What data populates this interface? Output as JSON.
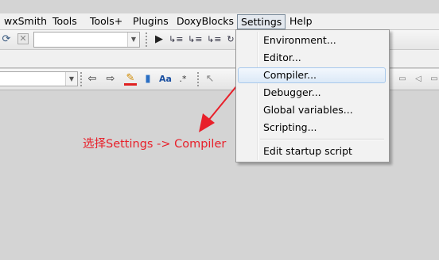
{
  "menubar": {
    "items": [
      "wxSmith",
      "Tools",
      "Tools+",
      "Plugins",
      "DoxyBlocks",
      "Settings",
      "Help"
    ],
    "open_index": 5
  },
  "settings_menu": {
    "items": [
      "Environment...",
      "Editor...",
      "Compiler...",
      "Debugger...",
      "Global variables...",
      "Scripting...",
      "Edit startup script"
    ],
    "highlighted": "Compiler..."
  },
  "toolbar1": {
    "icons": [
      "refresh-icon",
      "stop-icon",
      "run-icon",
      "debug-step-icon"
    ],
    "combo_value": ""
  },
  "toolbar2": {
    "combo_value": "",
    "icons": [
      "arrow-left-icon",
      "arrow-right-icon",
      "highlight-icon",
      "bookmark-icon",
      "match-case-icon",
      "regex-icon"
    ],
    "match_case_label": "Aa",
    "regex_label": ".*"
  },
  "annotation": {
    "text": "选择Settings -> Compiler",
    "color": "#e8202a"
  },
  "colors": {
    "menu_bg": "#f0f0f0",
    "workspace_bg": "#d4d4d4",
    "highlight_border": "#a8c9ec",
    "annotation_red": "#e8202a"
  }
}
